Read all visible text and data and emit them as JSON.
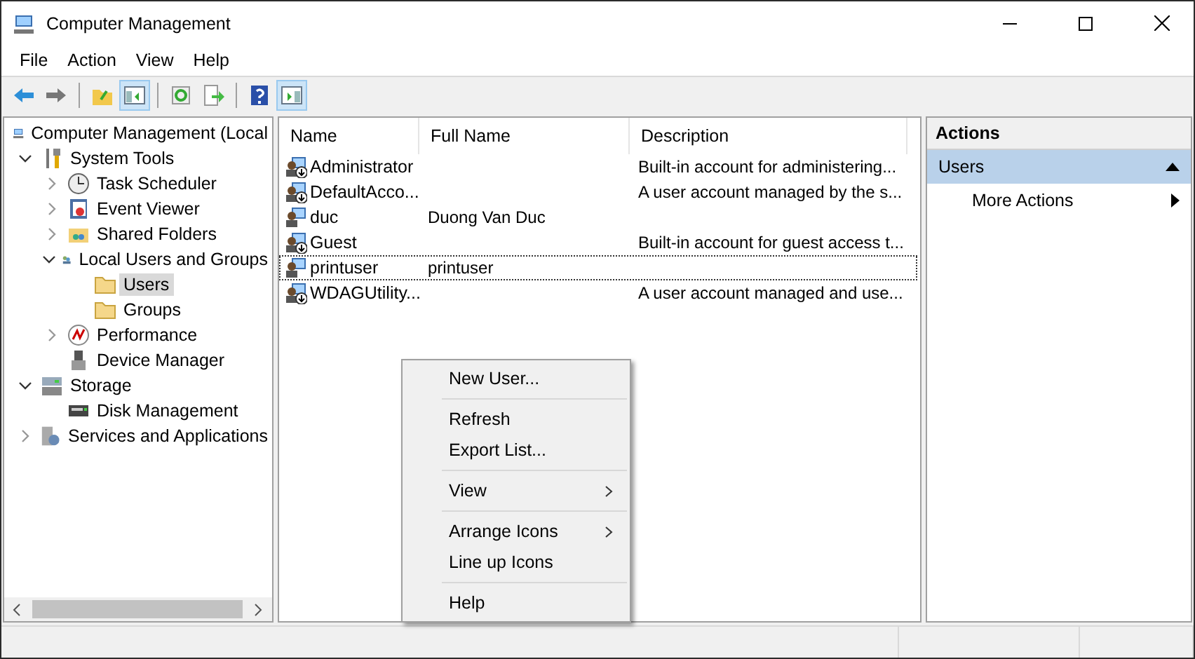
{
  "window": {
    "title": "Computer Management"
  },
  "menu_bar": [
    "File",
    "Action",
    "View",
    "Help"
  ],
  "toolbar": [
    {
      "kind": "back",
      "pressed": false
    },
    {
      "kind": "forward",
      "pressed": false
    },
    {
      "kind": "sep"
    },
    {
      "kind": "up",
      "pressed": false
    },
    {
      "kind": "tree",
      "pressed": true
    },
    {
      "kind": "sep"
    },
    {
      "kind": "refresh",
      "pressed": false
    },
    {
      "kind": "export",
      "pressed": false
    },
    {
      "kind": "sep"
    },
    {
      "kind": "help",
      "pressed": false
    },
    {
      "kind": "actionpane",
      "pressed": true
    }
  ],
  "tree": [
    {
      "label": "Computer Management (Local",
      "selected": false,
      "children": [
        {
          "label": "System Tools",
          "expanded": true,
          "selected": false,
          "children": [
            {
              "label": "Task Scheduler",
              "expanded": false,
              "selected": false
            },
            {
              "label": "Event Viewer",
              "expanded": false,
              "selected": false
            },
            {
              "label": "Shared Folders",
              "expanded": false,
              "selected": false
            },
            {
              "label": "Local Users and Groups",
              "expanded": true,
              "selected": false,
              "children": [
                {
                  "label": "Users",
                  "selected": true
                },
                {
                  "label": "Groups",
                  "selected": false
                }
              ]
            },
            {
              "label": "Performance",
              "expanded": false,
              "selected": false
            },
            {
              "label": "Device Manager",
              "selected": false
            }
          ]
        },
        {
          "label": "Storage",
          "expanded": true,
          "selected": false,
          "children": [
            {
              "label": "Disk Management",
              "selected": false
            }
          ]
        },
        {
          "label": "Services and Applications",
          "expanded": false,
          "selected": false
        }
      ]
    }
  ],
  "list": {
    "columns": [
      "Name",
      "Full Name",
      "Description"
    ],
    "rows": [
      {
        "name": "Administrator",
        "description": "Built-in account for administering...",
        "disabled": true,
        "focused": false
      },
      {
        "name": "DefaultAcco...",
        "description": "A user account managed by the s...",
        "disabled": true,
        "focused": false
      },
      {
        "name": "duc",
        "full_name": "Duong Van Duc",
        "disabled": false,
        "focused": false
      },
      {
        "name": "Guest",
        "description": "Built-in account for guest access t...",
        "disabled": true,
        "focused": false
      },
      {
        "name": "printuser",
        "full_name": "printuser",
        "disabled": false,
        "focused": true
      },
      {
        "name": "WDAGUtility...",
        "description": "A user account managed and use...",
        "disabled": true,
        "focused": false
      }
    ]
  },
  "context_menu": [
    {
      "kind": "item",
      "label": "New User...",
      "submenu": false
    },
    {
      "kind": "separator"
    },
    {
      "kind": "item",
      "label": "Refresh",
      "submenu": false
    },
    {
      "kind": "item",
      "label": "Export List...",
      "submenu": false
    },
    {
      "kind": "separator"
    },
    {
      "kind": "item",
      "label": "View",
      "submenu": true
    },
    {
      "kind": "separator"
    },
    {
      "kind": "item",
      "label": "Arrange Icons",
      "submenu": true
    },
    {
      "kind": "item",
      "label": "Line up Icons",
      "submenu": false
    },
    {
      "kind": "separator"
    },
    {
      "kind": "item",
      "label": "Help",
      "submenu": false
    }
  ],
  "actions": {
    "title": "Actions",
    "sections": [
      {
        "label": "Users",
        "expanded": true,
        "items": [
          {
            "label": "More Actions",
            "submenu": true
          }
        ]
      }
    ]
  }
}
